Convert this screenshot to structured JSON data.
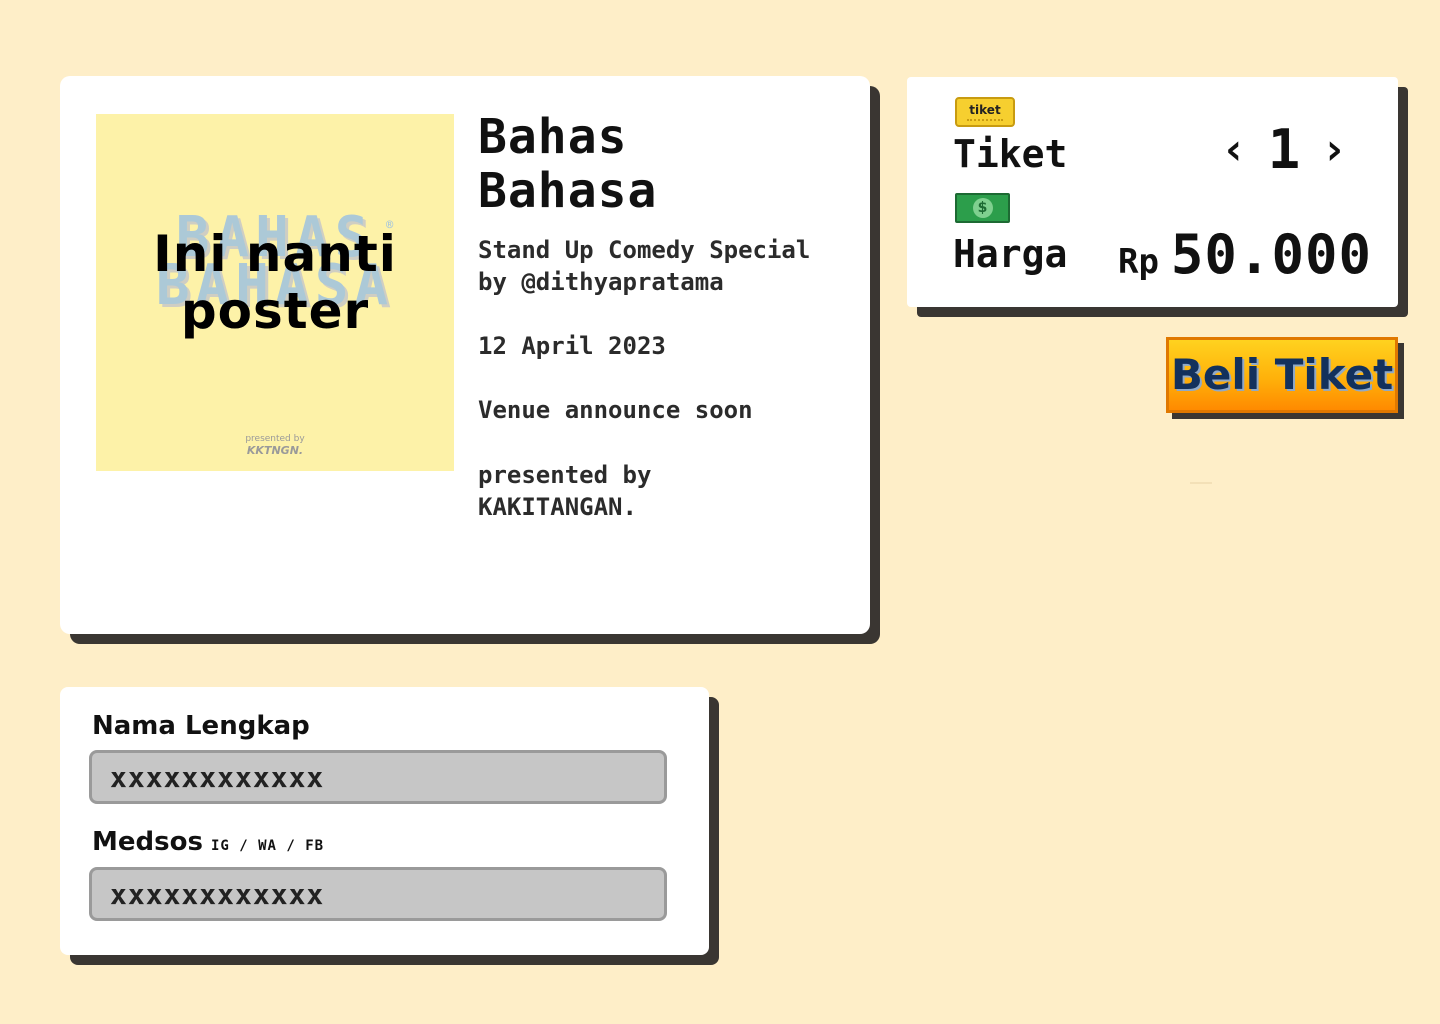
{
  "event": {
    "poster": {
      "logo_line1": "BAHAS",
      "logo_line2": "BAHASA",
      "placeholder_line1": "Ini nanti",
      "placeholder_line2": "poster",
      "presented_small": "presented by",
      "presented_brand": "KKTNGN."
    },
    "title_line1": "Bahas",
    "title_line2": "Bahasa",
    "subtitle_line1": "Stand Up Comedy Special",
    "subtitle_line2": "by @dithyapratama",
    "date": "12 April 2023",
    "venue": "Venue announce soon",
    "presented_line1": "presented by",
    "presented_line2": "KAKITANGAN."
  },
  "ticket": {
    "icon_label": "tiket",
    "label": "Tiket",
    "quantity": "1",
    "decrease_glyph": "‹",
    "increase_glyph": "›",
    "money_glyph": "$",
    "price_label": "Harga",
    "currency": "Rp",
    "price": "50.000"
  },
  "buy_button": {
    "label": "Beli Tiket"
  },
  "form": {
    "name_label": "Nama Lengkap",
    "name_value": "xxxxxxxxxxxx",
    "social_label": "Medsos",
    "social_hint": "IG / WA / FB",
    "social_value": "xxxxxxxxxxxx"
  },
  "colors": {
    "background": "#FEEEC8",
    "card": "#FFFFFF",
    "shadow": "#3A3632",
    "poster_bg": "#FDF2A8",
    "button_top": "#FFD21F",
    "button_bottom": "#FF8A00",
    "button_text": "#13315C",
    "input_bg": "#C6C6C6"
  }
}
